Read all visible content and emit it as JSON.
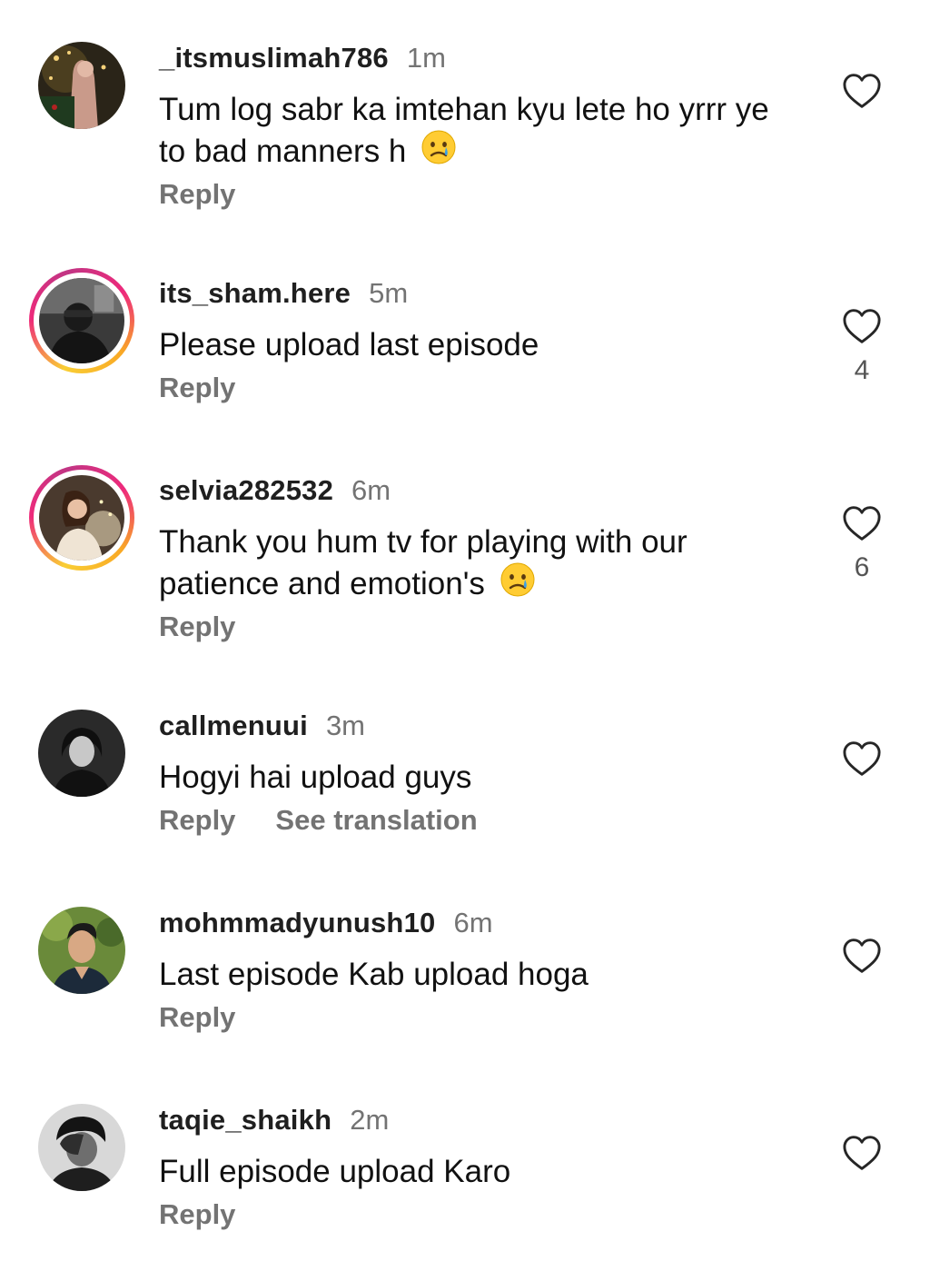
{
  "comments": [
    {
      "username": "_itsmuslimah786",
      "time": "1m",
      "text": "Tum log sabr ka imtehan kyu lete ho yrrr ye to bad manners h",
      "emoji": "crying-face",
      "actions": [
        "Reply"
      ],
      "likes": "",
      "story_ring": false
    },
    {
      "username": "its_sham.here",
      "time": "5m",
      "text": "Please upload last episode",
      "emoji": "",
      "actions": [
        "Reply"
      ],
      "likes": "4",
      "story_ring": true
    },
    {
      "username": "selvia282532",
      "time": "6m",
      "text": "Thank you hum tv for playing with our patience and emotion's",
      "emoji": "crying-face",
      "actions": [
        "Reply"
      ],
      "likes": "6",
      "story_ring": true
    },
    {
      "username": "callmenuui",
      "time": "3m",
      "text": "Hogyi hai upload guys",
      "emoji": "",
      "actions": [
        "Reply",
        "See translation"
      ],
      "likes": "",
      "story_ring": false
    },
    {
      "username": "mohmmadyunush10",
      "time": "6m",
      "text": "Last episode Kab upload hoga",
      "emoji": "",
      "actions": [
        "Reply"
      ],
      "likes": "",
      "story_ring": false
    },
    {
      "username": "taqie_shaikh",
      "time": "2m",
      "text": "Full episode upload Karo",
      "emoji": "",
      "actions": [
        "Reply"
      ],
      "likes": "",
      "story_ring": false
    }
  ],
  "colors": {
    "username": "#1f1f1f",
    "secondary_text": "#737373",
    "story_ring_gradient": [
      "#f9ce34",
      "#ee2a7b",
      "#c13584"
    ]
  }
}
